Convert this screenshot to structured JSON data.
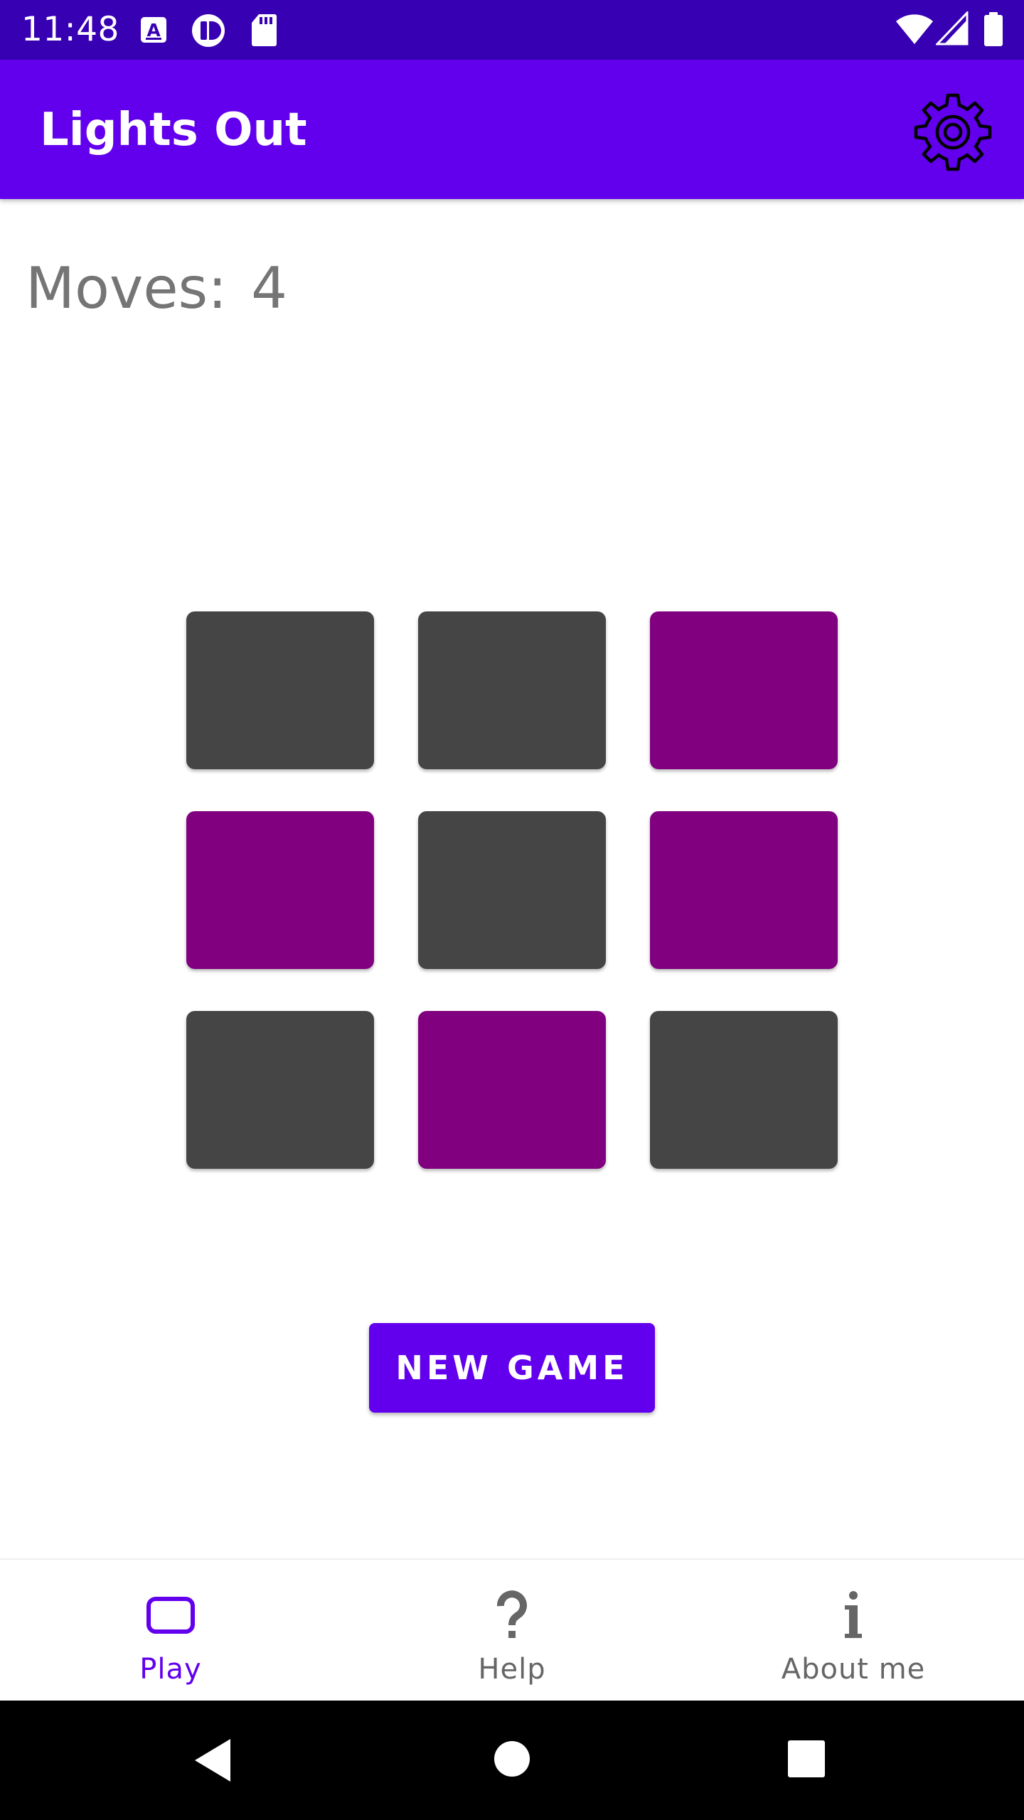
{
  "status_bar": {
    "time": "11:48",
    "background": "#3700b3",
    "icons": [
      "font-download-icon",
      "record-icon",
      "sd-card-icon",
      "wifi-icon",
      "signal-icon",
      "battery-icon"
    ]
  },
  "app_bar": {
    "title": "Lights Out",
    "background": "#6200ee",
    "action_icon": "gear-icon"
  },
  "game": {
    "moves_label": "Moves:",
    "moves_count": "4",
    "grid_rows": 3,
    "grid_cols": 3,
    "cells": [
      [
        "off",
        "off",
        "on"
      ],
      [
        "on",
        "off",
        "on"
      ],
      [
        "off",
        "on",
        "off"
      ]
    ],
    "on_color": "#800080",
    "off_color": "#454545"
  },
  "new_game_button": {
    "label": "NEW GAME",
    "color": "#6200ee"
  },
  "bottom_nav": {
    "items": [
      {
        "label": "Play",
        "icon": "play-icon",
        "active": true
      },
      {
        "label": "Help",
        "icon": "help-icon",
        "active": false
      },
      {
        "label": "About me",
        "icon": "info-icon",
        "active": false
      }
    ],
    "active_color": "#6200ee",
    "inactive_color": "#666666"
  },
  "system_nav": {
    "buttons": [
      "back-icon",
      "home-icon",
      "recents-icon"
    ]
  }
}
